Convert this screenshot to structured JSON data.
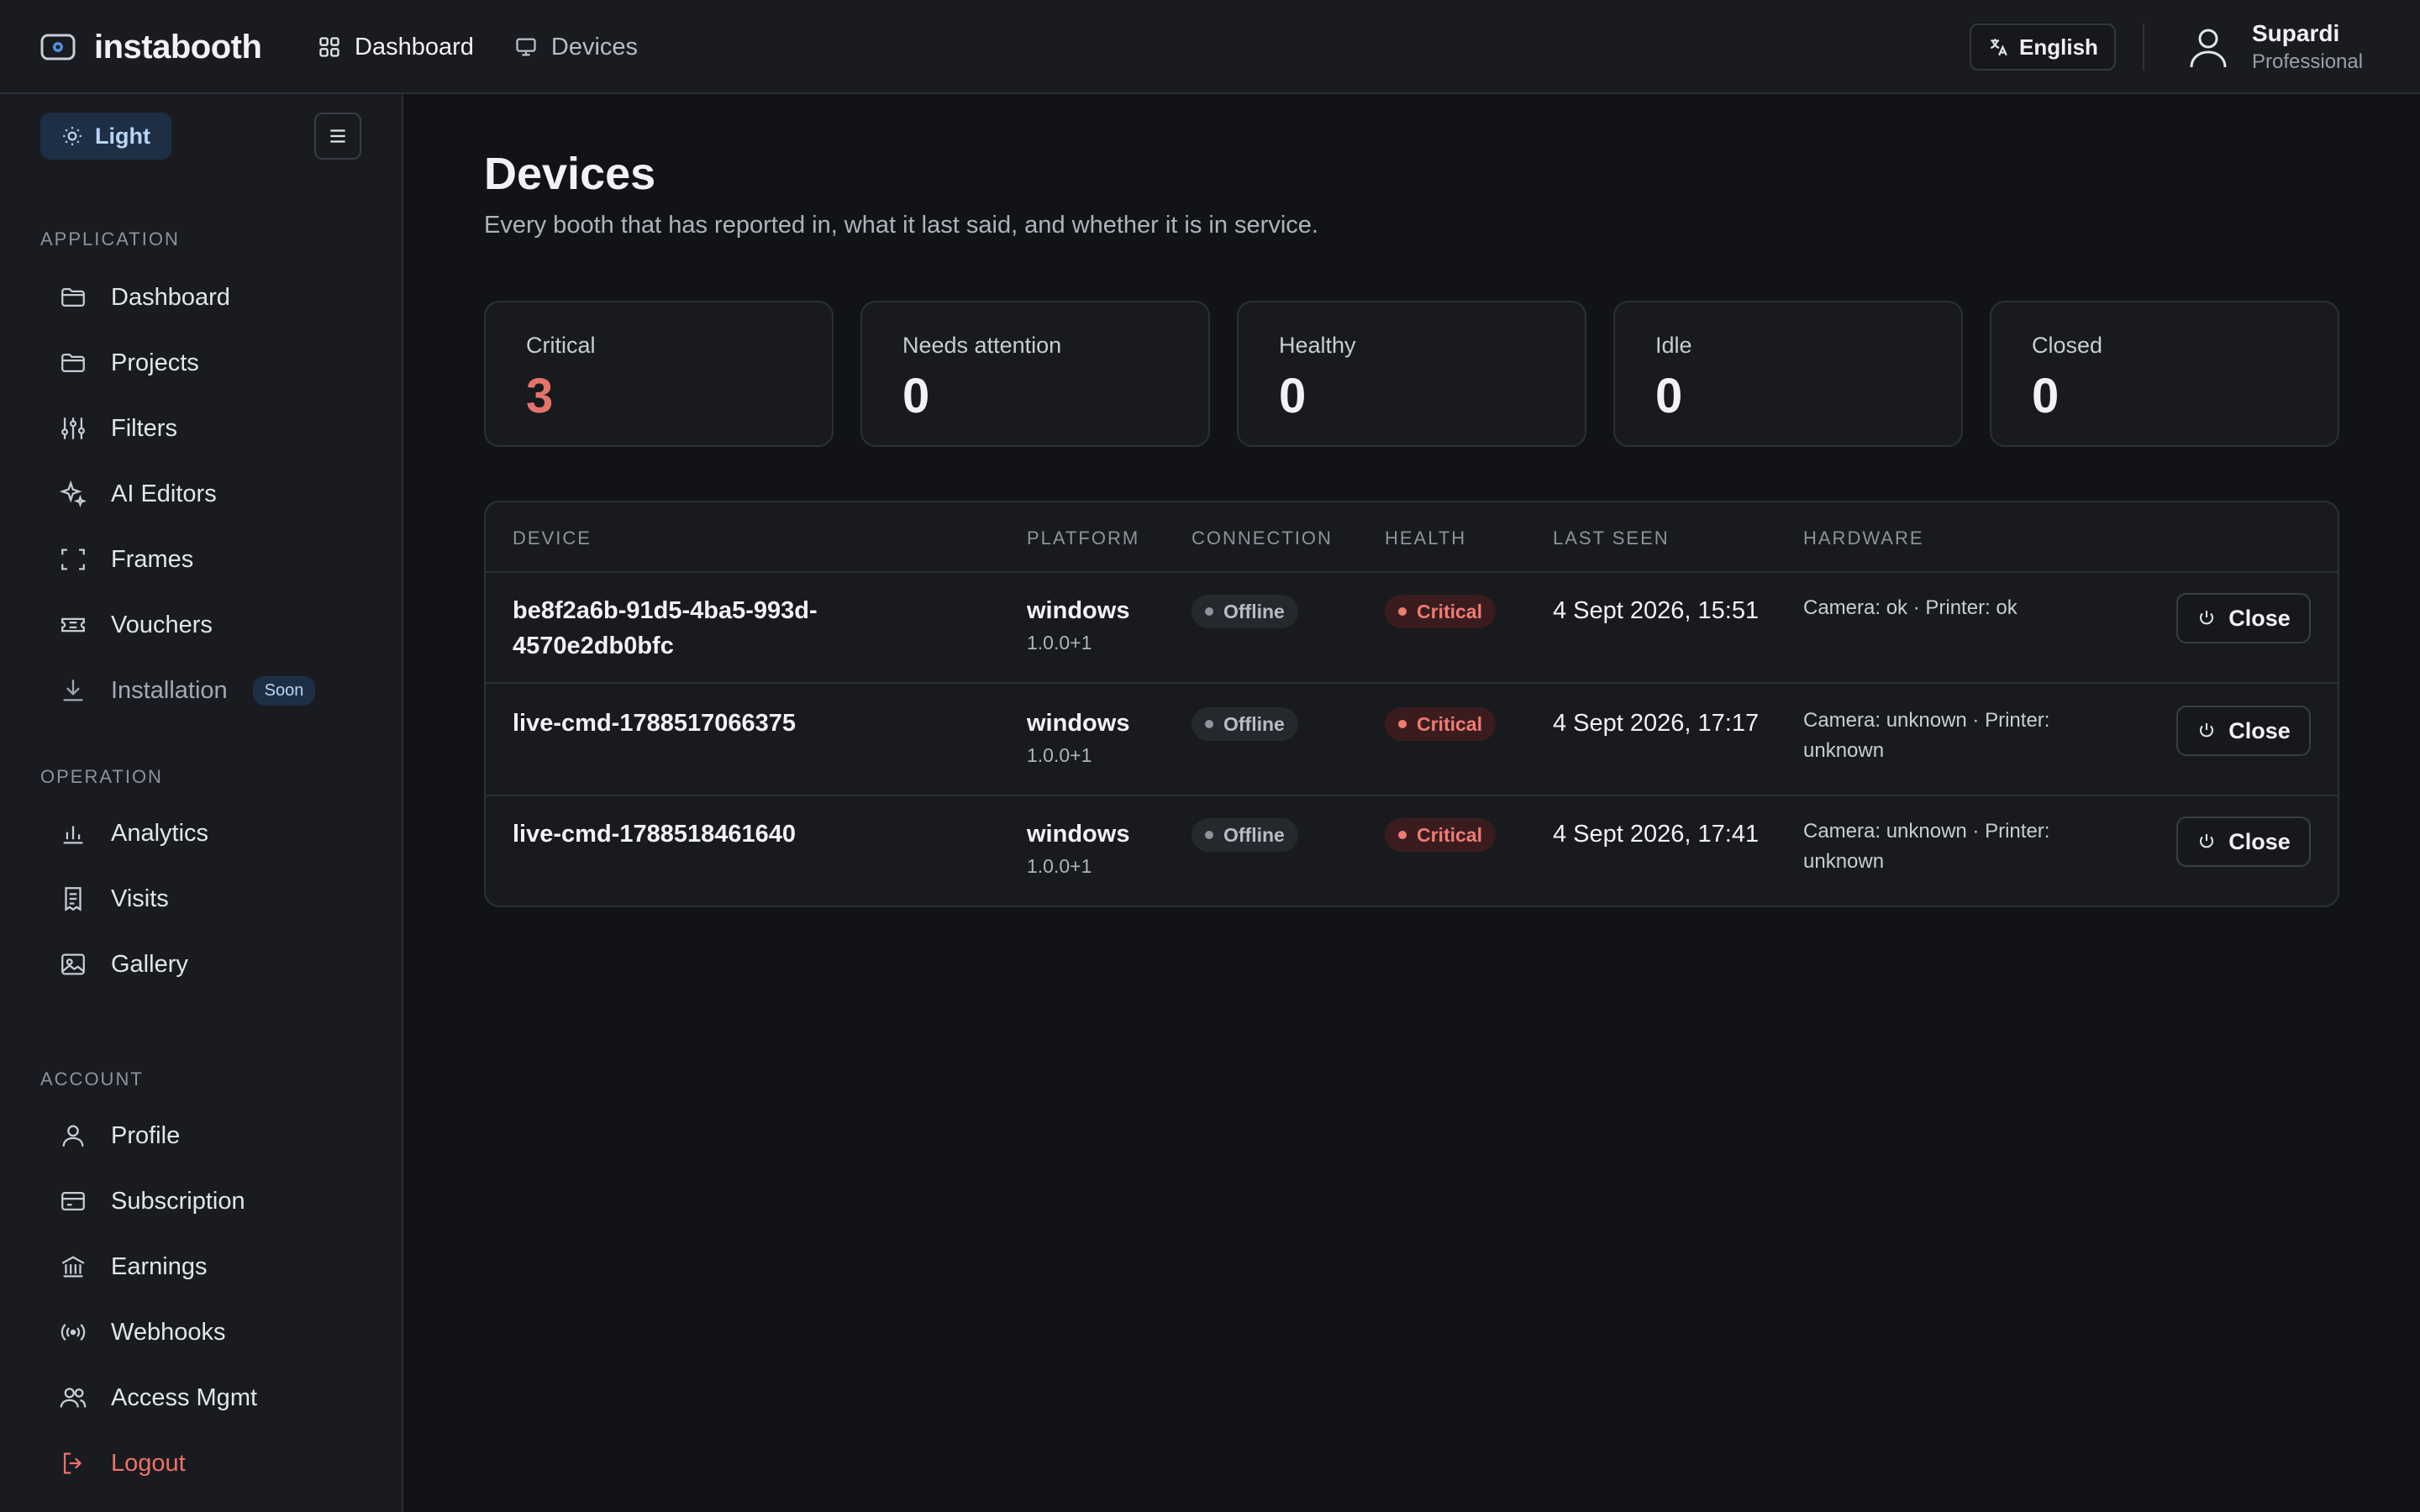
{
  "header": {
    "brand": "instabooth",
    "nav": [
      {
        "label": "Dashboard",
        "icon": "grid-icon"
      },
      {
        "label": "Devices",
        "icon": "monitor-icon"
      }
    ],
    "language": "English",
    "user": {
      "name": "Supardi",
      "plan": "Professional"
    }
  },
  "sidebar": {
    "theme_label": "Light",
    "sections": {
      "application": "APPLICATION",
      "operation": "OPERATION",
      "account": "ACCOUNT"
    },
    "application_items": [
      {
        "label": "Dashboard",
        "icon": "folder-icon"
      },
      {
        "label": "Projects",
        "icon": "folder-icon"
      },
      {
        "label": "Filters",
        "icon": "sliders-icon"
      },
      {
        "label": "AI Editors",
        "icon": "sparkles-icon"
      },
      {
        "label": "Frames",
        "icon": "frame-icon"
      },
      {
        "label": "Vouchers",
        "icon": "ticket-icon"
      },
      {
        "label": "Installation",
        "icon": "download-icon",
        "badge": "Soon"
      }
    ],
    "operation_items": [
      {
        "label": "Analytics",
        "icon": "bar-chart-icon"
      },
      {
        "label": "Visits",
        "icon": "receipt-icon"
      },
      {
        "label": "Gallery",
        "icon": "image-icon"
      }
    ],
    "account_items": [
      {
        "label": "Profile",
        "icon": "user-icon"
      },
      {
        "label": "Subscription",
        "icon": "credit-card-icon"
      },
      {
        "label": "Earnings",
        "icon": "bank-icon"
      },
      {
        "label": "Webhooks",
        "icon": "broadcast-icon"
      },
      {
        "label": "Access Mgmt",
        "icon": "users-icon"
      },
      {
        "label": "Logout",
        "icon": "logout-icon"
      }
    ]
  },
  "page": {
    "title": "Devices",
    "subtitle": "Every booth that has reported in, what it last said, and whether it is in service."
  },
  "stats": [
    {
      "label": "Critical",
      "value": "3"
    },
    {
      "label": "Needs attention",
      "value": "0"
    },
    {
      "label": "Healthy",
      "value": "0"
    },
    {
      "label": "Idle",
      "value": "0"
    },
    {
      "label": "Closed",
      "value": "0"
    }
  ],
  "table": {
    "columns": [
      "DEVICE",
      "PLATFORM",
      "CONNECTION",
      "HEALTH",
      "LAST SEEN",
      "HARDWARE"
    ],
    "rows": [
      {
        "device": "be8f2a6b-91d5-4ba5-993d-4570e2db0bfc",
        "platform": "windows",
        "version": "1.0.0+1",
        "connection": "Offline",
        "health": "Critical",
        "last_seen": "4 Sept 2026, 15:51",
        "hardware": "Camera: ok · Printer: ok",
        "action": "Close"
      },
      {
        "device": "live-cmd-1788517066375",
        "platform": "windows",
        "version": "1.0.0+1",
        "connection": "Offline",
        "health": "Critical",
        "last_seen": "4 Sept 2026, 17:17",
        "hardware": "Camera: unknown · Printer: unknown",
        "action": "Close"
      },
      {
        "device": "live-cmd-1788518461640",
        "platform": "windows",
        "version": "1.0.0+1",
        "connection": "Offline",
        "health": "Critical",
        "last_seen": "4 Sept 2026, 17:41",
        "hardware": "Camera: unknown · Printer: unknown",
        "action": "Close"
      }
    ]
  },
  "colors": {
    "background": "#111317",
    "panel": "#191b20",
    "critical": "#e5736c",
    "accent": "#b9d4f5"
  }
}
